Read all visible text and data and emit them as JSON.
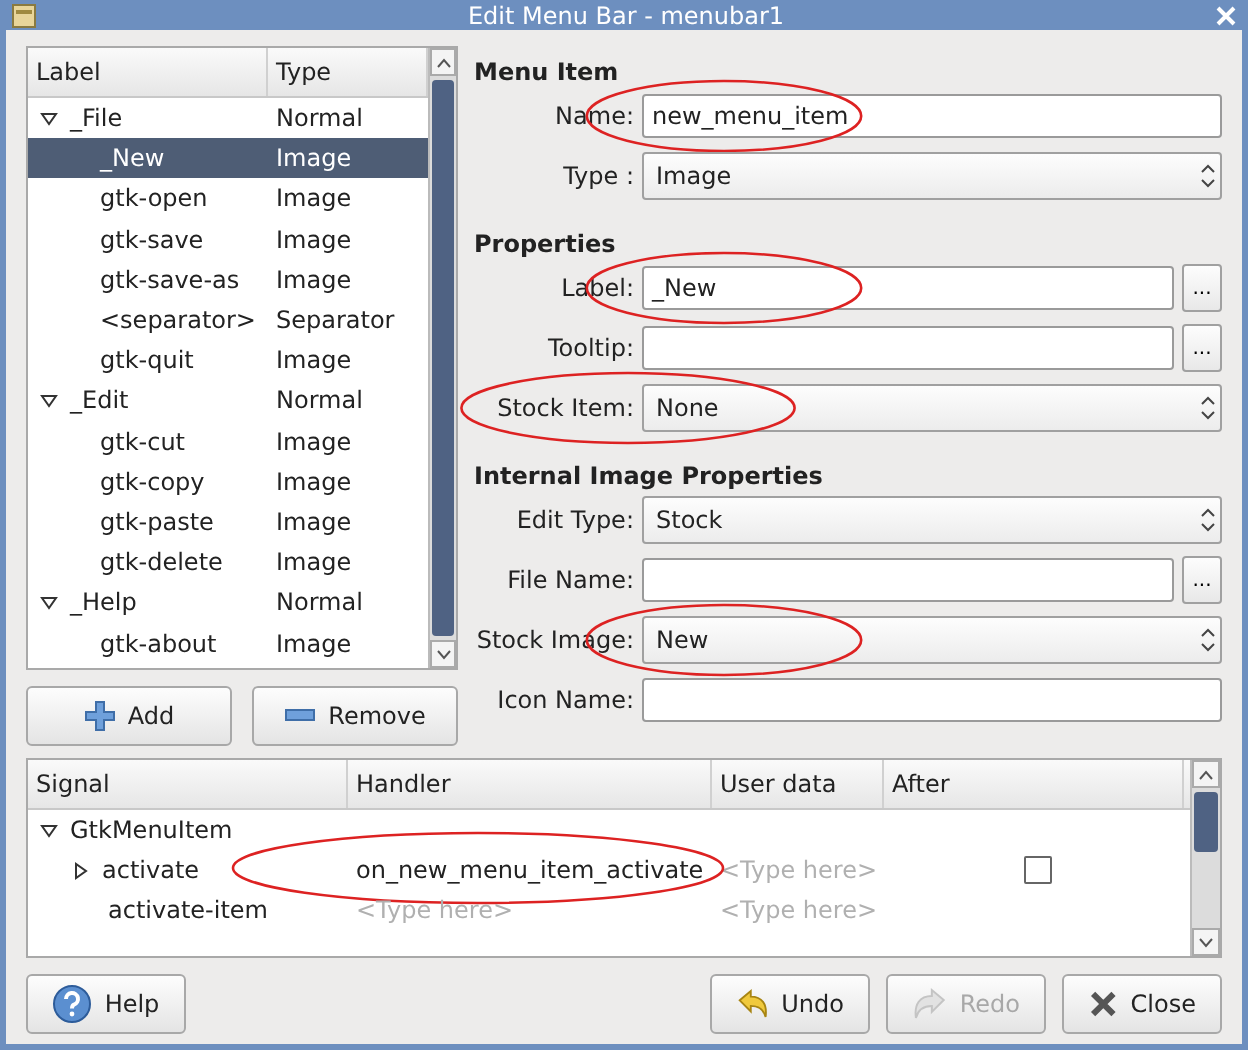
{
  "window": {
    "title": "Edit Menu Bar - menubar1"
  },
  "tree": {
    "columns": [
      "Label",
      "Type"
    ],
    "items": [
      {
        "label": "_File",
        "type": "Normal",
        "selected": false,
        "expanded": true,
        "children": [
          {
            "label": "_New",
            "type": "Image",
            "selected": true
          },
          {
            "label": "gtk-open",
            "type": "Image",
            "selected": false
          },
          {
            "label": "gtk-save",
            "type": "Image",
            "selected": false
          },
          {
            "label": "gtk-save-as",
            "type": "Image",
            "selected": false
          },
          {
            "label": "<separator>",
            "type": "Separator",
            "selected": false
          },
          {
            "label": "gtk-quit",
            "type": "Image",
            "selected": false
          }
        ]
      },
      {
        "label": "_Edit",
        "type": "Normal",
        "selected": false,
        "expanded": true,
        "children": [
          {
            "label": "gtk-cut",
            "type": "Image",
            "selected": false
          },
          {
            "label": "gtk-copy",
            "type": "Image",
            "selected": false
          },
          {
            "label": "gtk-paste",
            "type": "Image",
            "selected": false
          },
          {
            "label": "gtk-delete",
            "type": "Image",
            "selected": false
          }
        ]
      },
      {
        "label": "_Help",
        "type": "Normal",
        "selected": false,
        "expanded": true,
        "children": [
          {
            "label": "gtk-about",
            "type": "Image",
            "selected": false
          }
        ]
      }
    ]
  },
  "tree_buttons": [
    {
      "label": "Add",
      "kind": "add"
    },
    {
      "label": "Remove",
      "kind": "remove"
    }
  ],
  "sections": [
    {
      "title": "Menu Item",
      "fields": [
        {
          "label": "Name:",
          "kind": "entry",
          "value": "new_menu_item",
          "circled": true
        },
        {
          "label": "Type :",
          "kind": "combo",
          "value": "Image",
          "circled": false
        }
      ]
    },
    {
      "title": "Properties",
      "fields": [
        {
          "label": "Label:",
          "kind": "entry_button",
          "value": "_New",
          "button": "...",
          "circled": true
        },
        {
          "label": "Tooltip:",
          "kind": "entry_button",
          "button": "...",
          "circled": false
        },
        {
          "label": "Stock Item:",
          "kind": "combo",
          "value": "None",
          "circled": true
        }
      ]
    },
    {
      "title": "Internal Image Properties",
      "fields": [
        {
          "label": "Edit Type:",
          "kind": "combo",
          "value": "Stock",
          "circled": false
        },
        {
          "label": "File Name:",
          "kind": "entry_button",
          "button": "...",
          "circled": false
        },
        {
          "label": "Stock Image:",
          "kind": "combo",
          "value": "New",
          "circled": true
        },
        {
          "label": "Icon Name:",
          "kind": "entry",
          "circled": false
        }
      ]
    }
  ],
  "signals": {
    "columns": [
      "Signal",
      "Handler",
      "User data",
      "After"
    ],
    "rows": [
      {
        "signal": "GtkMenuItem",
        "kind": "group",
        "expanded": true
      },
      {
        "signal": "activate",
        "kind": "signal",
        "expanded": false,
        "handler": "on_new_menu_item_activate",
        "handler_placeholder": false,
        "user_data": "<Type here>",
        "after": false,
        "circled": true
      },
      {
        "signal": "activate-item",
        "kind": "signal_leaf",
        "handler": "<Type here>",
        "handler_placeholder": true,
        "user_data": "<Type here>",
        "circled": false
      }
    ]
  },
  "buttons": [
    {
      "label": "Help",
      "kind": "help",
      "disabled": false
    },
    {
      "label": "Undo",
      "kind": "undo",
      "disabled": false
    },
    {
      "label": "Redo",
      "kind": "redo",
      "disabled": true
    },
    {
      "label": "Close",
      "kind": "close",
      "disabled": false
    }
  ]
}
